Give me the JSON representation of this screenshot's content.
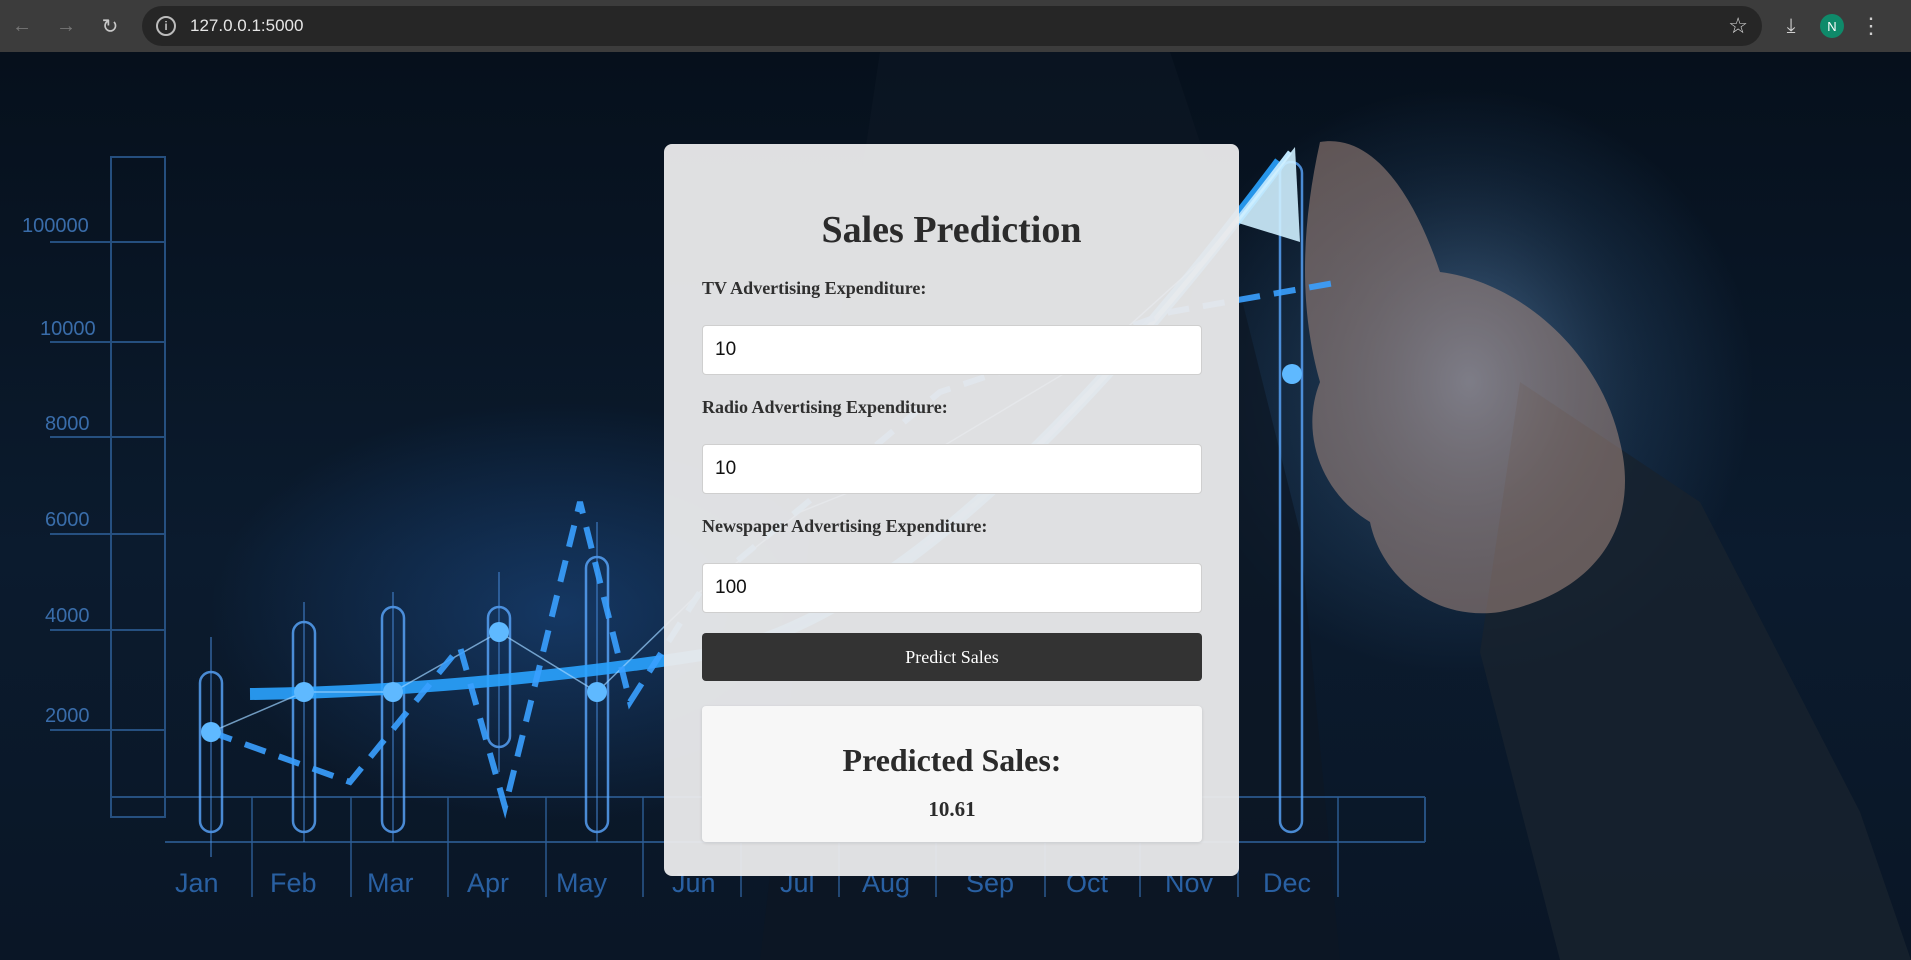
{
  "browser": {
    "url": "127.0.0.1:5000",
    "profile_initial": "N"
  },
  "background_chart": {
    "y_ticks": [
      "100000",
      "10000",
      "8000",
      "6000",
      "4000",
      "2000"
    ],
    "months": [
      "Jan",
      "Feb",
      "Mar",
      "Apr",
      "May",
      "Jun",
      "Jul",
      "Aug",
      "Sep",
      "Oct",
      "Nov",
      "Dec"
    ]
  },
  "form": {
    "title": "Sales Prediction",
    "tv_label": "TV Advertising Expenditure:",
    "tv_value": "10",
    "radio_label": "Radio Advertising Expenditure:",
    "radio_value": "10",
    "newspaper_label": "Newspaper Advertising Expenditure:",
    "newspaper_value": "100",
    "submit_label": "Predict Sales"
  },
  "result": {
    "heading": "Predicted Sales:",
    "value": "10.61"
  },
  "colors": {
    "card_bg": "#ebebec",
    "button_bg": "#333333",
    "page_bg": "#0a1220",
    "glow": "#2aa3ff"
  }
}
